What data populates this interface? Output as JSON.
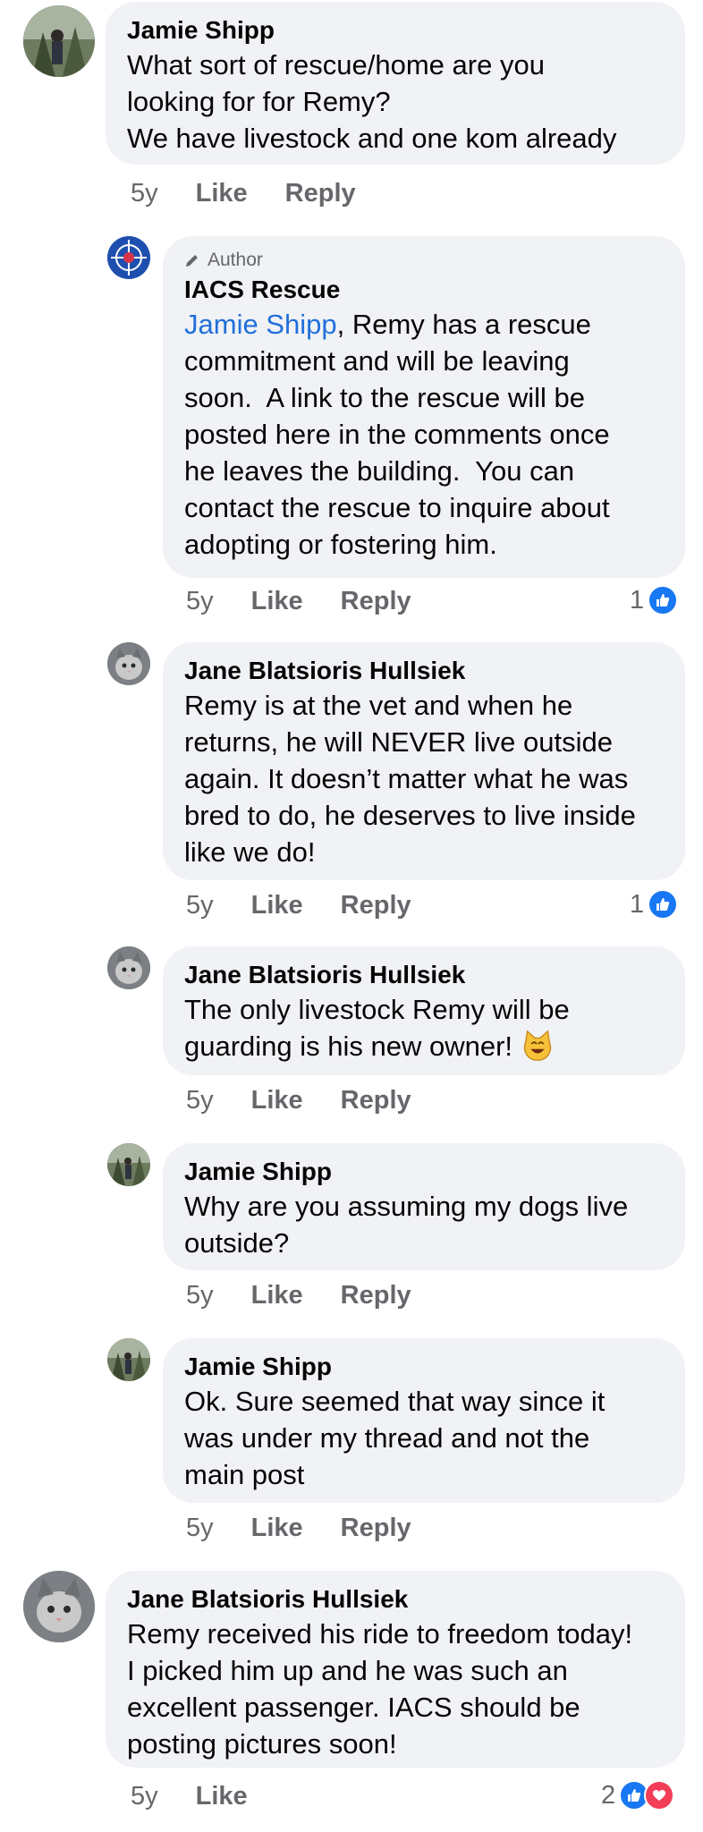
{
  "comments": [
    {
      "name": "Jamie Shipp",
      "text": "What sort of rescue/home are you\nlooking for for Remy?\nWe have livestock and one kom already",
      "age": "5y",
      "like": "Like",
      "reply": "Reply"
    },
    {
      "author_badge": "Author",
      "name": "IACS Rescue",
      "mention": "Jamie Shipp",
      "text": ", Remy has a rescue\ncommitment and will be leaving\nsoon.  A link to the rescue will be\nposted here in the comments once\nhe leaves the building.  You can\ncontact the rescue to inquire about\nadopting or fostering him.",
      "age": "5y",
      "like": "Like",
      "reply": "Reply",
      "reaction_count": "1",
      "reactions": [
        "like-icon"
      ]
    },
    {
      "name": "Jane Blatsioris Hullsiek",
      "text": "Remy is at the vet and when he\nreturns, he will NEVER live outside\nagain. It doesn’t matter what he was\nbred to do, he deserves to live inside\nlike we do!",
      "age": "5y",
      "like": "Like",
      "reply": "Reply",
      "reaction_count": "1",
      "reactions": [
        "like-icon"
      ]
    },
    {
      "name": "Jane Blatsioris Hullsiek",
      "text": "The only livestock Remy will be\nguarding is his new owner! ",
      "emoji": "smiling-cat-emoji",
      "age": "5y",
      "like": "Like",
      "reply": "Reply"
    },
    {
      "name": "Jamie Shipp",
      "text": "Why are you assuming my dogs live\noutside?",
      "age": "5y",
      "like": "Like",
      "reply": "Reply"
    },
    {
      "name": "Jamie Shipp",
      "text": "Ok. Sure seemed that way since it\nwas under my thread and not the\nmain post",
      "age": "5y",
      "like": "Like",
      "reply": "Reply"
    },
    {
      "name": "Jane Blatsioris Hullsiek",
      "text": "Remy received his ride to freedom today!\nI picked him up and he was such an\nexcellent passenger. IACS should be\nposting pictures soon!",
      "age": "5y",
      "like": "Like",
      "reaction_count": "2",
      "reactions": [
        "like-icon",
        "love-icon"
      ]
    }
  ],
  "colors": {
    "bubble": "#f0f2f5",
    "mention": "#216fdb",
    "meta": "#65676b",
    "like": "#1877f2",
    "love": "#f33e58"
  }
}
